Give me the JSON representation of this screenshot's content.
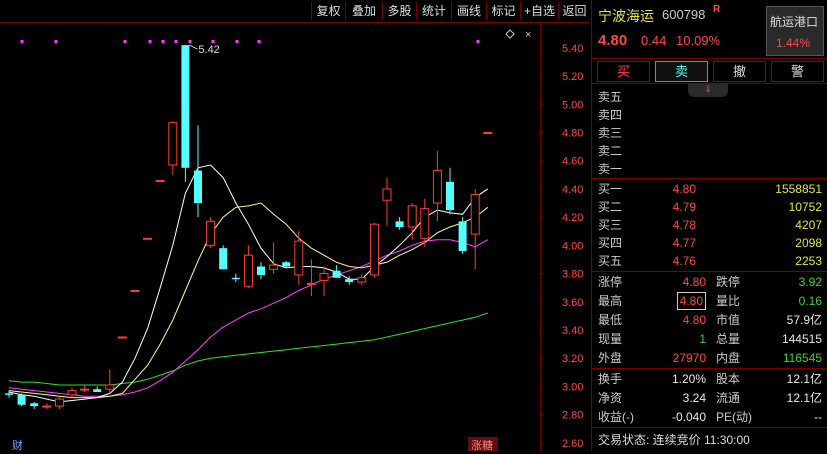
{
  "toolbar": {
    "buttons": [
      "复权",
      "叠加",
      "多股",
      "统计",
      "画线",
      "标记",
      "+自选",
      "返回"
    ]
  },
  "stock": {
    "name": "宁波海运",
    "code": "600798",
    "flag": "R",
    "sector": "航运港口",
    "sector_change": "1.44%",
    "price": "4.80",
    "change": "0.44",
    "change_pct": "10.09%"
  },
  "actions": {
    "buy": "买",
    "sell": "卖",
    "cancel": "撤",
    "alert": "警"
  },
  "expand_icon": "double-chevron-down-icon",
  "order_book": {
    "asks": [
      {
        "label": "卖五",
        "price": "",
        "volume": ""
      },
      {
        "label": "卖四",
        "price": "",
        "volume": ""
      },
      {
        "label": "卖三",
        "price": "",
        "volume": ""
      },
      {
        "label": "卖二",
        "price": "",
        "volume": ""
      },
      {
        "label": "卖一",
        "price": "",
        "volume": ""
      }
    ],
    "bids": [
      {
        "label": "买一",
        "price": "4.80",
        "volume": "1558851"
      },
      {
        "label": "买二",
        "price": "4.79",
        "volume": "10752"
      },
      {
        "label": "买三",
        "price": "4.78",
        "volume": "4207"
      },
      {
        "label": "买四",
        "price": "4.77",
        "volume": "2098"
      },
      {
        "label": "买五",
        "price": "4.76",
        "volume": "2253"
      }
    ]
  },
  "quote": [
    {
      "l1": "涨停",
      "v1": "4.80",
      "c1": "red",
      "l2": "跌停",
      "v2": "3.92",
      "c2": "green"
    },
    {
      "l1": "最高",
      "v1": "4.80",
      "c1": "red",
      "l2": "量比",
      "v2": "0.16",
      "c2": "green"
    },
    {
      "l1": "最低",
      "v1": "4.80",
      "c1": "red",
      "l2": "市值",
      "v2": "57.9亿",
      "c2": "white"
    },
    {
      "l1": "现量",
      "v1": "1",
      "c1": "green",
      "l2": "总量",
      "v2": "144515",
      "c2": "white"
    },
    {
      "l1": "外盘",
      "v1": "27970",
      "c1": "red",
      "l2": "内盘",
      "v2": "116545",
      "c2": "green"
    }
  ],
  "stats": [
    {
      "l1": "换手",
      "v1": "1.20%",
      "l2": "股本",
      "v2": "12.1亿"
    },
    {
      "l1": "净资",
      "v1": "3.24",
      "l2": "流通",
      "v2": "12.1亿"
    },
    {
      "l1": "收益(-)",
      "v1": "-0.040",
      "l2": "PE(动)",
      "v2": "--"
    }
  ],
  "trade_status": "交易状态: 连续竞价 11:30:00",
  "chart_markers": {
    "left": "财",
    "right": "涨糖"
  },
  "chart_data": {
    "type": "candlestick",
    "price_axis_ticks": [
      "5.40",
      "5.20",
      "5.00",
      "4.80",
      "4.60",
      "4.40",
      "4.20",
      "4.00",
      "3.80",
      "3.60",
      "3.40",
      "3.20",
      "3.00",
      "2.80",
      "2.60"
    ],
    "ylim": [
      2.57,
      5.52
    ],
    "high_annotation": "5.42",
    "colors": {
      "up": "#ff3c3c",
      "down": "#54ffff",
      "ma5": "#ffffff",
      "ma10": "#ffff80",
      "ma20": "#ff40ff",
      "ma60": "#30e030",
      "grid": "#700000"
    },
    "candles": [
      {
        "o": 2.95,
        "h": 2.97,
        "l": 2.92,
        "c": 2.94
      },
      {
        "o": 2.94,
        "h": 2.95,
        "l": 2.86,
        "c": 2.87
      },
      {
        "o": 2.88,
        "h": 2.89,
        "l": 2.84,
        "c": 2.86
      },
      {
        "o": 2.86,
        "h": 2.88,
        "l": 2.84,
        "c": 2.86
      },
      {
        "o": 2.86,
        "h": 2.93,
        "l": 2.84,
        "c": 2.91
      },
      {
        "o": 2.94,
        "h": 2.99,
        "l": 2.92,
        "c": 2.97
      },
      {
        "o": 2.98,
        "h": 3.01,
        "l": 2.96,
        "c": 2.98
      },
      {
        "o": 2.98,
        "h": 3.0,
        "l": 2.96,
        "c": 2.96
      },
      {
        "o": 2.98,
        "h": 3.12,
        "l": 2.96,
        "c": 3.01
      },
      {
        "o": 3.35,
        "h": 3.35,
        "l": 3.35,
        "c": 3.35
      },
      {
        "o": 3.68,
        "h": 3.68,
        "l": 3.68,
        "c": 3.68
      },
      {
        "o": 4.05,
        "h": 4.05,
        "l": 4.05,
        "c": 4.05
      },
      {
        "o": 4.46,
        "h": 4.46,
        "l": 4.46,
        "c": 4.46
      },
      {
        "o": 4.57,
        "h": 4.88,
        "l": 4.5,
        "c": 4.87
      },
      {
        "o": 5.42,
        "h": 5.42,
        "l": 4.45,
        "c": 4.55
      },
      {
        "o": 4.53,
        "h": 4.85,
        "l": 4.2,
        "c": 4.3
      },
      {
        "o": 4.0,
        "h": 4.2,
        "l": 3.98,
        "c": 4.17
      },
      {
        "o": 3.98,
        "h": 4.0,
        "l": 3.83,
        "c": 3.83
      },
      {
        "o": 3.77,
        "h": 3.8,
        "l": 3.74,
        "c": 3.76
      },
      {
        "o": 3.71,
        "h": 4.0,
        "l": 3.7,
        "c": 3.93
      },
      {
        "o": 3.85,
        "h": 3.88,
        "l": 3.76,
        "c": 3.79
      },
      {
        "o": 3.83,
        "h": 4.02,
        "l": 3.8,
        "c": 3.86
      },
      {
        "o": 3.88,
        "h": 3.89,
        "l": 3.84,
        "c": 3.85
      },
      {
        "o": 3.79,
        "h": 4.1,
        "l": 3.72,
        "c": 4.03
      },
      {
        "o": 3.73,
        "h": 3.9,
        "l": 3.64,
        "c": 3.73
      },
      {
        "o": 3.75,
        "h": 3.85,
        "l": 3.64,
        "c": 3.8
      },
      {
        "o": 3.82,
        "h": 3.86,
        "l": 3.77,
        "c": 3.77
      },
      {
        "o": 3.76,
        "h": 3.78,
        "l": 3.72,
        "c": 3.74
      },
      {
        "o": 3.74,
        "h": 3.8,
        "l": 3.72,
        "c": 3.77
      },
      {
        "o": 3.79,
        "h": 4.16,
        "l": 3.77,
        "c": 4.15
      },
      {
        "o": 4.32,
        "h": 4.48,
        "l": 4.14,
        "c": 4.4
      },
      {
        "o": 4.17,
        "h": 4.2,
        "l": 4.11,
        "c": 4.13
      },
      {
        "o": 4.13,
        "h": 4.3,
        "l": 4.04,
        "c": 4.28
      },
      {
        "o": 4.05,
        "h": 4.33,
        "l": 3.99,
        "c": 4.26
      },
      {
        "o": 4.3,
        "h": 4.67,
        "l": 4.17,
        "c": 4.53
      },
      {
        "o": 4.45,
        "h": 4.55,
        "l": 4.22,
        "c": 4.25
      },
      {
        "o": 4.17,
        "h": 4.2,
        "l": 3.94,
        "c": 3.96
      },
      {
        "o": 4.08,
        "h": 4.4,
        "l": 3.83,
        "c": 4.36
      },
      {
        "o": 4.8,
        "h": 4.8,
        "l": 4.8,
        "c": 4.8
      }
    ],
    "ma5": [
      2.96,
      2.94,
      2.93,
      2.91,
      2.89,
      2.9,
      2.91,
      2.92,
      2.95,
      3.03,
      3.2,
      3.41,
      3.7,
      4.0,
      4.37,
      4.55,
      4.57,
      4.48,
      4.3,
      4.15,
      3.98,
      3.87,
      3.84,
      3.85,
      3.85,
      3.84,
      3.81,
      3.76,
      3.76,
      3.85,
      3.92,
      4.0,
      4.09,
      4.2,
      4.25,
      4.23,
      4.22,
      4.34,
      4.4
    ],
    "ma10": [
      2.97,
      2.96,
      2.95,
      2.94,
      2.93,
      2.92,
      2.92,
      2.92,
      2.93,
      2.95,
      3.05,
      3.15,
      3.3,
      3.47,
      3.68,
      3.89,
      4.08,
      4.2,
      4.27,
      4.28,
      4.3,
      4.22,
      4.15,
      4.05,
      3.98,
      3.93,
      3.88,
      3.85,
      3.84,
      3.86,
      3.88,
      3.93,
      3.97,
      4.02,
      4.09,
      4.13,
      4.16,
      4.2,
      4.27
    ],
    "ma20": [
      2.99,
      2.98,
      2.97,
      2.96,
      2.95,
      2.94,
      2.93,
      2.93,
      2.93,
      2.94,
      2.96,
      2.99,
      3.04,
      3.1,
      3.18,
      3.26,
      3.35,
      3.42,
      3.47,
      3.52,
      3.55,
      3.59,
      3.63,
      3.68,
      3.72,
      3.76,
      3.79,
      3.82,
      3.85,
      3.89,
      3.93,
      3.96,
      4.0,
      4.03,
      4.04,
      4.04,
      4.02,
      3.99,
      4.04
    ],
    "ma60": [
      3.04,
      3.03,
      3.03,
      3.02,
      3.01,
      3.01,
      3.01,
      3.01,
      3.01,
      3.02,
      3.03,
      3.05,
      3.08,
      3.11,
      3.15,
      3.18,
      3.2,
      3.21,
      3.22,
      3.23,
      3.24,
      3.25,
      3.26,
      3.27,
      3.28,
      3.29,
      3.3,
      3.31,
      3.32,
      3.33,
      3.35,
      3.37,
      3.39,
      3.41,
      3.43,
      3.45,
      3.47,
      3.49,
      3.52
    ]
  }
}
